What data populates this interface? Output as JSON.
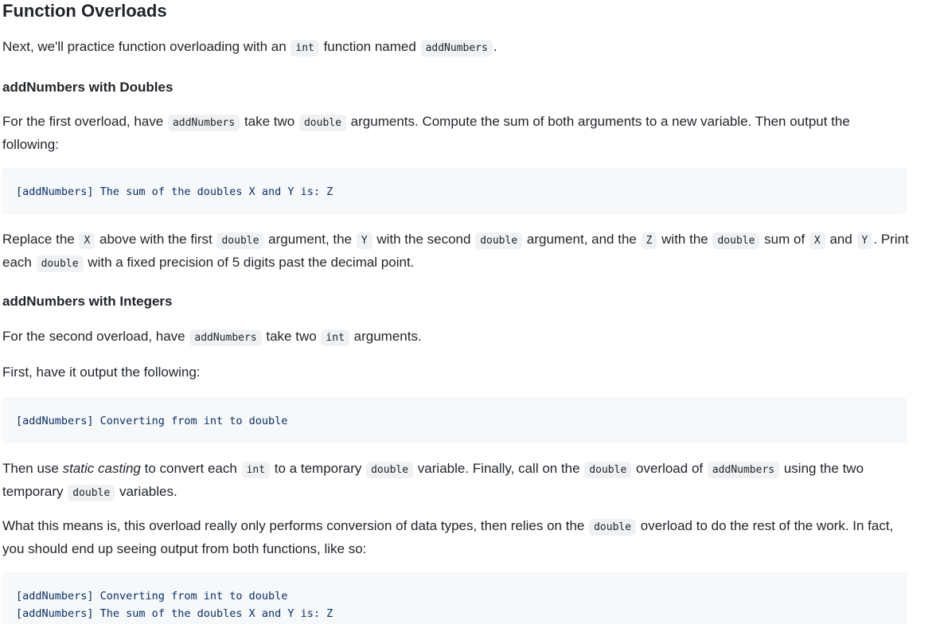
{
  "heading": "Function Overloads",
  "intro": {
    "t1": "Next, we'll practice function overloading with an ",
    "c1": "int",
    "t2": " function named ",
    "c2": "addNumbers",
    "t3": "."
  },
  "doubles_section": {
    "heading": "addNumbers with Doubles",
    "p1": {
      "t1": "For the first overload, have ",
      "c1": "addNumbers",
      "t2": " take two ",
      "c2": "double",
      "t3": " arguments. Compute the sum of both arguments to a new variable. Then output the following:"
    },
    "code": "[addNumbers] The sum of the doubles X and Y is: Z",
    "p2": {
      "t1": "Replace the ",
      "c1": "X",
      "t2": " above with the first ",
      "c2": "double",
      "t3": " argument, the ",
      "c3": "Y",
      "t4": " with the second ",
      "c4": "double",
      "t5": " argument, and the ",
      "c5": "Z",
      "t6": " with the ",
      "c6": "double",
      "t7": " sum of ",
      "c7": "X",
      "t8": " and ",
      "c8": "Y",
      "t9": ". Print each ",
      "c9": "double",
      "t10": " with a fixed precision of 5 digits past the decimal point."
    }
  },
  "integers_section": {
    "heading": "addNumbers with Integers",
    "p1": {
      "t1": "For the second overload, have ",
      "c1": "addNumbers",
      "t2": " take two ",
      "c2": "int",
      "t3": " arguments."
    },
    "p2": "First, have it output the following:",
    "code": "[addNumbers] Converting from int to double",
    "p3": {
      "t1": "Then use ",
      "em": "static casting",
      "t2": " to convert each ",
      "c1": "int",
      "t3": " to a temporary ",
      "c2": "double",
      "t4": " variable. Finally, call on the ",
      "c3": "double",
      "t5": " overload of ",
      "c4": "addNumbers",
      "t6": " using the two temporary ",
      "c5": "double",
      "t7": " variables."
    },
    "p4": {
      "t1": "What this means is, this overload really only performs conversion of data types, then relies on the ",
      "c1": "double",
      "t2": " overload to do the rest of the work. In fact, you should end up seeing output from both functions, like so:"
    },
    "code2": [
      "[addNumbers] Converting from int to double",
      "[addNumbers] The sum of the doubles X and Y is: Z"
    ]
  }
}
